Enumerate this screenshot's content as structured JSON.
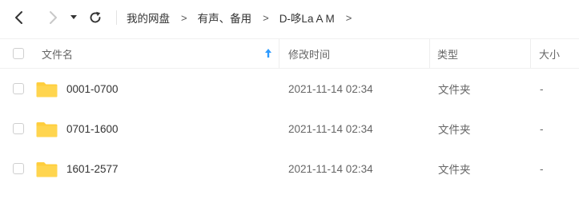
{
  "toolbar": {
    "back_icon": "chevron-left-icon",
    "forward_icon": "chevron-right-icon",
    "dropdown_icon": "caret-down-icon",
    "refresh_icon": "refresh-icon"
  },
  "breadcrumb": {
    "items": [
      "我的网盘",
      "有声、备用",
      "D-哆La A M"
    ],
    "separator": ">"
  },
  "table": {
    "columns": {
      "name": "文件名",
      "modified": "修改时间",
      "type": "类型",
      "size": "大小"
    },
    "sort_indicator": "arrow-up-icon",
    "rows": [
      {
        "name": "0001-0700",
        "modified": "2021-11-14 02:34",
        "type": "文件夹",
        "size": "-"
      },
      {
        "name": "0701-1600",
        "modified": "2021-11-14 02:34",
        "type": "文件夹",
        "size": "-"
      },
      {
        "name": "1601-2577",
        "modified": "2021-11-14 02:34",
        "type": "文件夹",
        "size": "-"
      }
    ]
  },
  "colors": {
    "folder": "#FFCE3D",
    "sort_arrow": "#2E9BFF",
    "text_primary": "#333333",
    "text_secondary": "#666666"
  }
}
